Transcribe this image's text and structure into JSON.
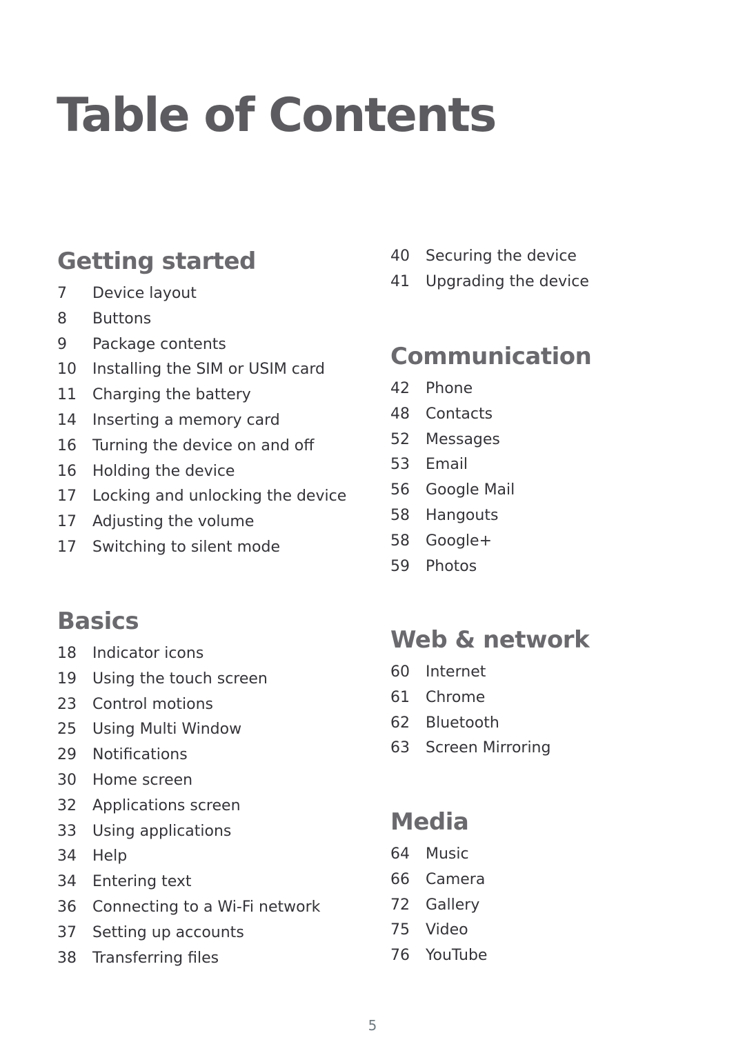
{
  "title": "Table of Contents",
  "sections": [
    {
      "heading": "Getting started",
      "items": [
        {
          "page": "7",
          "label": "Device layout"
        },
        {
          "page": "8",
          "label": "Buttons"
        },
        {
          "page": "9",
          "label": "Package contents"
        },
        {
          "page": "10",
          "label": "Installing the SIM or USIM card"
        },
        {
          "page": "11",
          "label": "Charging the battery"
        },
        {
          "page": "14",
          "label": "Inserting a memory card"
        },
        {
          "page": "16",
          "label": "Turning the device on and off"
        },
        {
          "page": "16",
          "label": "Holding the device"
        },
        {
          "page": "17",
          "label": "Locking and unlocking the device"
        },
        {
          "page": "17",
          "label": "Adjusting the volume"
        },
        {
          "page": "17",
          "label": "Switching to silent mode"
        }
      ]
    },
    {
      "heading": "Basics",
      "items": [
        {
          "page": "18",
          "label": "Indicator icons"
        },
        {
          "page": "19",
          "label": "Using the touch screen"
        },
        {
          "page": "23",
          "label": "Control motions"
        },
        {
          "page": "25",
          "label": "Using Multi Window"
        },
        {
          "page": "29",
          "label": "Notifications"
        },
        {
          "page": "30",
          "label": "Home screen"
        },
        {
          "page": "32",
          "label": "Applications screen"
        },
        {
          "page": "33",
          "label": "Using applications"
        },
        {
          "page": "34",
          "label": "Help"
        },
        {
          "page": "34",
          "label": "Entering text"
        },
        {
          "page": "36",
          "label": "Connecting to a Wi-Fi network"
        },
        {
          "page": "37",
          "label": "Setting up accounts"
        },
        {
          "page": "38",
          "label": "Transferring files"
        }
      ]
    },
    {
      "heading": "",
      "items": [
        {
          "page": "40",
          "label": "Securing the device"
        },
        {
          "page": "41",
          "label": "Upgrading the device"
        }
      ]
    },
    {
      "heading": "Communication",
      "items": [
        {
          "page": "42",
          "label": "Phone"
        },
        {
          "page": "48",
          "label": "Contacts"
        },
        {
          "page": "52",
          "label": "Messages"
        },
        {
          "page": "53",
          "label": "Email"
        },
        {
          "page": "56",
          "label": "Google Mail"
        },
        {
          "page": "58",
          "label": "Hangouts"
        },
        {
          "page": "58",
          "label": "Google+"
        },
        {
          "page": "59",
          "label": "Photos"
        }
      ]
    },
    {
      "heading": "Web & network",
      "items": [
        {
          "page": "60",
          "label": "Internet"
        },
        {
          "page": "61",
          "label": "Chrome"
        },
        {
          "page": "62",
          "label": "Bluetooth"
        },
        {
          "page": "63",
          "label": "Screen Mirroring"
        }
      ]
    },
    {
      "heading": "Media",
      "items": [
        {
          "page": "64",
          "label": "Music"
        },
        {
          "page": "66",
          "label": "Camera"
        },
        {
          "page": "72",
          "label": "Gallery"
        },
        {
          "page": "75",
          "label": "Video"
        },
        {
          "page": "76",
          "label": "YouTube"
        }
      ]
    }
  ],
  "page_number": "5"
}
